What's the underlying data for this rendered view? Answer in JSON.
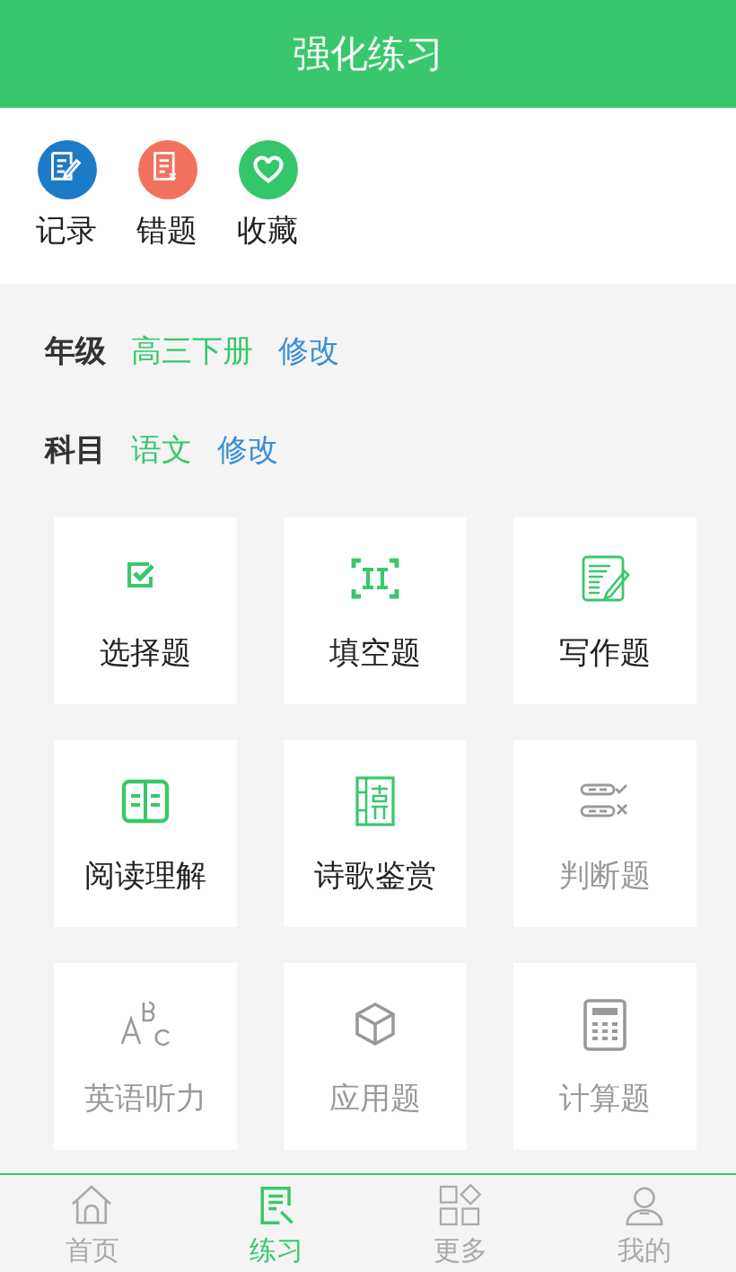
{
  "header": {
    "title": "强化练习"
  },
  "shortcuts": [
    {
      "label": "记录",
      "color": "#1d7ac6"
    },
    {
      "label": "错题",
      "color": "#f2725f"
    },
    {
      "label": "收藏",
      "color": "#34c76a"
    }
  ],
  "settings": [
    {
      "label": "年级",
      "value": "高三下册",
      "action": "修改"
    },
    {
      "label": "科目",
      "value": "语文",
      "action": "修改"
    }
  ],
  "exercises": [
    {
      "label": "选择题",
      "disabled": false
    },
    {
      "label": "填空题",
      "disabled": false
    },
    {
      "label": "写作题",
      "disabled": false
    },
    {
      "label": "阅读理解",
      "disabled": false
    },
    {
      "label": "诗歌鉴赏",
      "disabled": false
    },
    {
      "label": "判断题",
      "disabled": true
    },
    {
      "label": "英语听力",
      "disabled": true
    },
    {
      "label": "应用题",
      "disabled": true
    },
    {
      "label": "计算题",
      "disabled": true
    }
  ],
  "tabs": [
    {
      "label": "首页",
      "selected": false
    },
    {
      "label": "练习",
      "selected": true
    },
    {
      "label": "更多",
      "selected": false
    },
    {
      "label": "我的",
      "selected": false
    }
  ]
}
